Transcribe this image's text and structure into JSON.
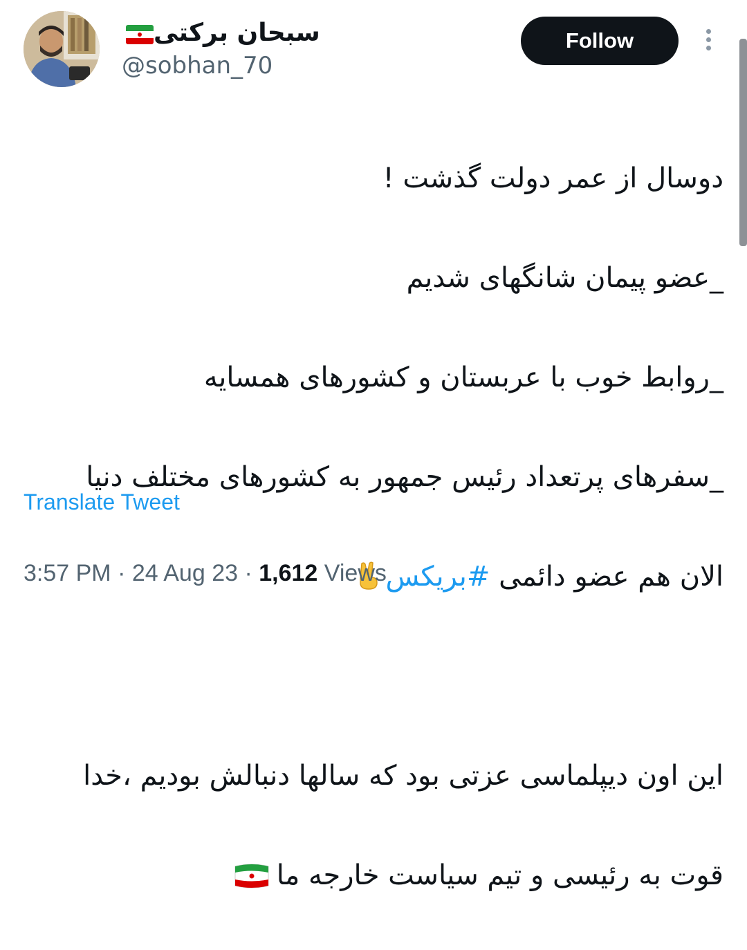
{
  "author": {
    "display_name": "سبحان برکتی",
    "handle": "@sobhan_70",
    "avatar_icon": "profile-photo",
    "flag_icon": "iran-flag-icon"
  },
  "header": {
    "follow_label": "Follow",
    "more_icon": "more-vertical-icon"
  },
  "tweet": {
    "lines": [
      "دوسال از عمر دولت گذشت !",
      "_عضو پیمان شانگهای شدیم",
      "_روابط خوب با عربستان و کشورهای همسایه",
      "_سفرهای پرتعداد رئیس جمهور به کشورهای مختلف دنیا"
    ],
    "line5_prefix": "الان هم عضو دائمی ",
    "hashtag": "#بریکس",
    "line5_emoji": "victory-hand-icon",
    "line7": "این اون دیپلماسی عزتی بود که سالها دنبالش بودیم ،خدا",
    "line8": "قوت به رئیسی و تیم سیاست خارجه ما",
    "line8_emoji": "iran-flag-icon"
  },
  "translate_label": "Translate Tweet",
  "meta": {
    "time": "3:57 PM",
    "separator": "·",
    "date": "24 Aug 23",
    "views_count": "1,612",
    "views_label": "Views"
  },
  "colors": {
    "text": "#0f1419",
    "secondary": "#536471",
    "link": "#1d9bf0",
    "button_bg": "#0f1419"
  }
}
